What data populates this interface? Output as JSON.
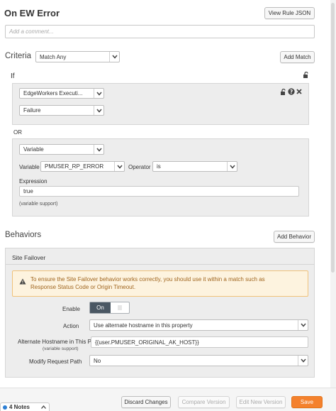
{
  "rule": {
    "title": "On EW Error",
    "view_json_label": "View Rule JSON",
    "comment_placeholder": "Add a comment..."
  },
  "criteria": {
    "heading": "Criteria",
    "match_select": "Match Any",
    "add_match_label": "Add Match",
    "if_label": "If",
    "or_label": "OR",
    "group1": {
      "condition": "EdgeWorkers Executi...",
      "value": "Failure"
    },
    "group2": {
      "condition": "Variable",
      "variable_label": "Variable",
      "variable_value": "PMUSER_RP_ERROR",
      "operator_label": "Operator",
      "operator_value": "is",
      "expression_label": "Expression",
      "expression_value": "true",
      "variable_support": "(variable support)"
    }
  },
  "behaviors": {
    "heading": "Behaviors",
    "add_behavior_label": "Add Behavior",
    "site_failover": {
      "title": "Site Failover",
      "warning": "To ensure the Site Failover behavior works correctly, you should use it within a match such as Response Status Code or Origin Timeout.",
      "enable_label": "Enable",
      "toggle_on": "On",
      "action_label": "Action",
      "action_value": "Use alternate hostname in this property",
      "alt_host_label": "Alternate Hostname in This Pr",
      "alt_host_sub": "(variable support)",
      "alt_host_value": "{{user.PMUSER_ORIGINAL_AK_HOST}}",
      "modify_path_label": "Modify Request Path",
      "modify_path_value": "No"
    }
  },
  "footer": {
    "discard_label": "Discard Changes",
    "compare_label": "Compare Version",
    "edit_new_label": "Edit New Version",
    "save_label": "Save",
    "notes_label": "4 Notes"
  },
  "colors": {
    "accent": "#f4812d",
    "warning_bg": "#fdf3df",
    "warning_border": "#f0c27a",
    "toggle_on": "#4a5763"
  }
}
